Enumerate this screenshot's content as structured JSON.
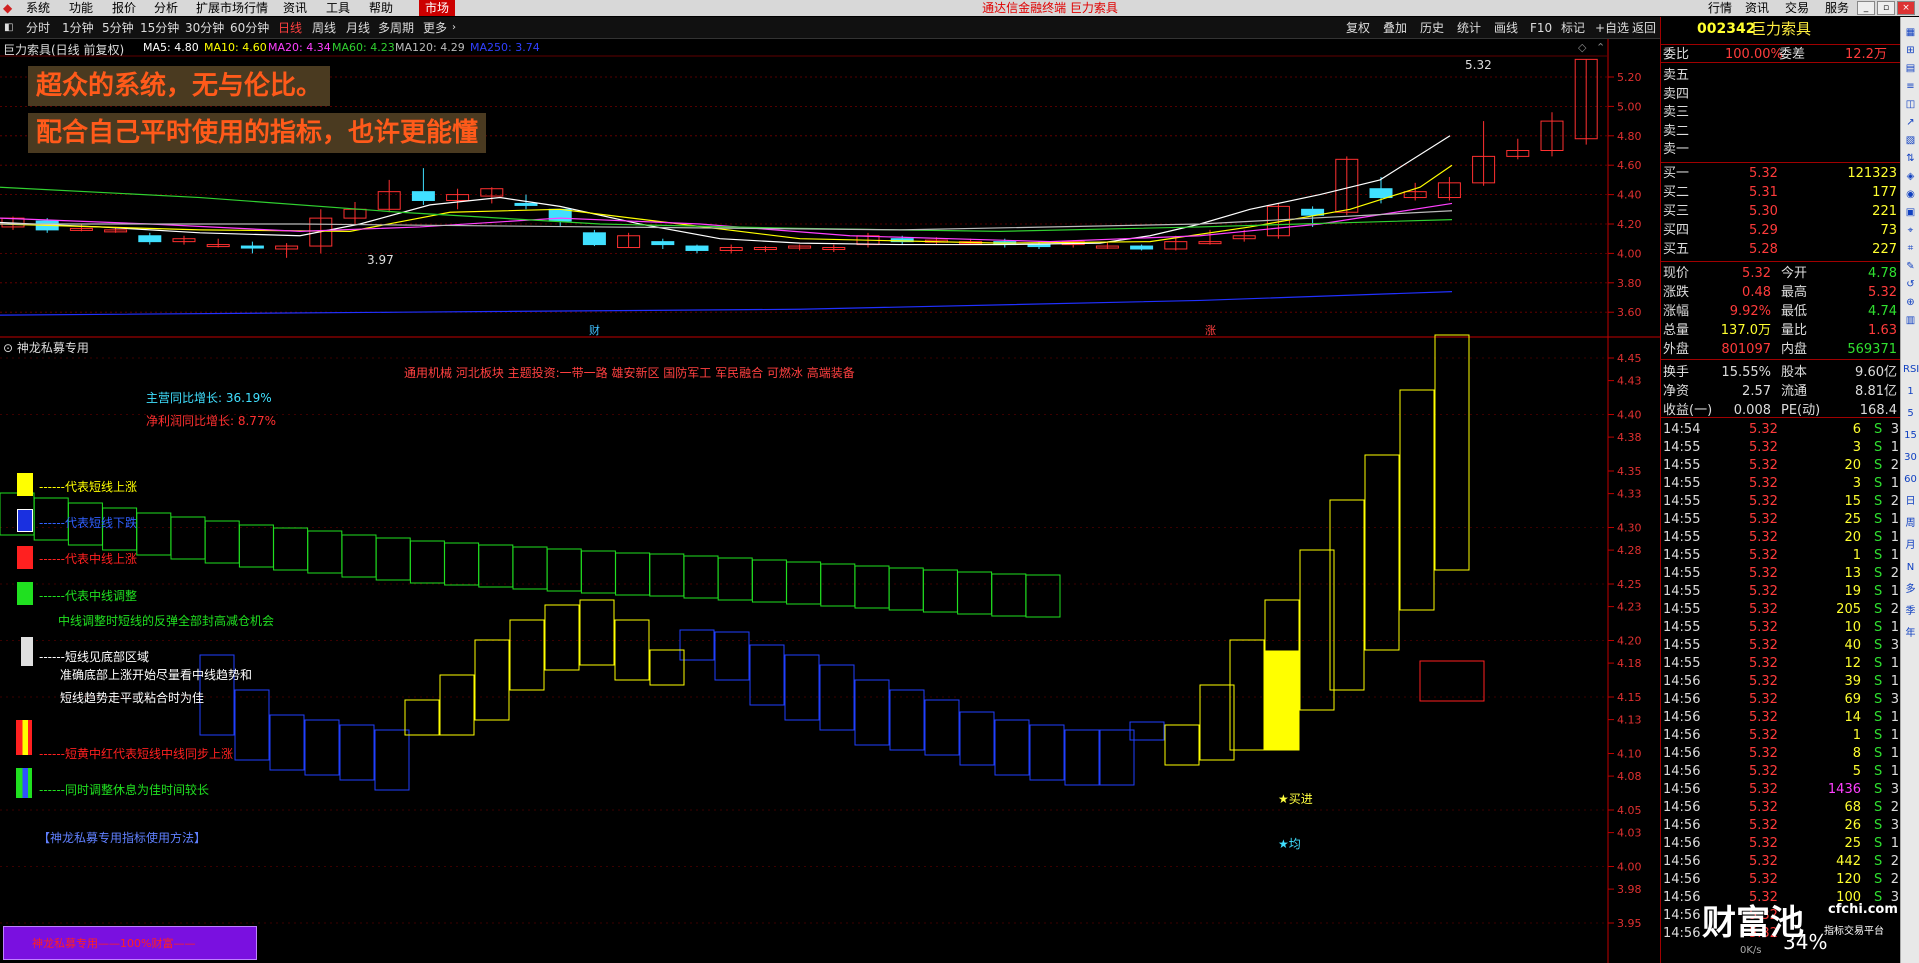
{
  "menu": {
    "items": [
      "系统",
      "功能",
      "报价",
      "分析",
      "扩展市场行情",
      "资讯",
      "工具",
      "帮助"
    ],
    "market": "市场",
    "app_title": "通达信金融终端  巨力索具",
    "right_items": [
      "行情",
      "资讯",
      "交易",
      "服务"
    ]
  },
  "periods": [
    "分时",
    "1分钟",
    "5分钟",
    "15分钟",
    "30分钟",
    "60分钟",
    "日线",
    "周线",
    "月线",
    "多周期",
    "更多"
  ],
  "active_period": "日线",
  "tools": [
    "复权",
    "叠加",
    "历史",
    "统计",
    "画线",
    "F10",
    "标记",
    "+自选",
    "返回"
  ],
  "kline": {
    "title": "巨力索具(日线 前复权)",
    "ma": [
      {
        "label": "MA5: 4.80",
        "color": "#ffffff"
      },
      {
        "label": "MA10: 4.60",
        "color": "#ffff00"
      },
      {
        "label": "MA20: 4.34",
        "color": "#ff40ff"
      },
      {
        "label": "MA60: 4.23",
        "color": "#30d030"
      },
      {
        "label": "MA120: 4.29",
        "color": "#bbbbbb"
      },
      {
        "label": "MA250: 3.74",
        "color": "#3040ff"
      }
    ],
    "high_label": "5.32",
    "low_label": "3.97",
    "marker_cai": "财",
    "marker_zhang": "涨",
    "y_ticks": [
      "5.20",
      "5.00",
      "4.80",
      "4.60",
      "4.40",
      "4.20",
      "4.00",
      "3.80",
      "3.60"
    ],
    "banner1": "超众的系统，无与伦比。",
    "banner2": "配合自己平时使用的指标，也许更能懂"
  },
  "indicator": {
    "title": "神龙私募专用",
    "concepts": "通用机械 河北板块 主题投资:一带一路 雄安新区 国防军工 军民融合 可燃冰 高端装备",
    "revenue": "主营同比增长: 36.19%",
    "profit": "净利润同比增长: 8.77%",
    "legend": [
      {
        "text": "------代表短线上涨",
        "color": "#ffff00"
      },
      {
        "text": "------代表短线下跌",
        "color": "#3060ff"
      },
      {
        "text": "------代表中线上涨",
        "color": "#ff2020"
      },
      {
        "text": "------代表中线调整",
        "color": "#20e020"
      },
      {
        "text": "中线调整时短线的反弹全部封高减仓机会",
        "color": "#20e020"
      },
      {
        "text": "------短线见底部区域",
        "color": "#ffffff"
      },
      {
        "text": "准确底部上涨开始尽量看中线趋势和",
        "color": "#ffffff"
      },
      {
        "text": "短线趋势走平或粘合时为佳",
        "color": "#ffffff"
      },
      {
        "text": "------短黄中红代表短线中线同步上涨",
        "color": "#ff2020"
      },
      {
        "text": "------同时调整休息为佳时间较长",
        "color": "#20e020"
      }
    ],
    "method_link": "【神龙私募专用指标使用方法】",
    "buy_label": "★买进",
    "avg_label": "★均",
    "footer_box": "神龙私募专用——100%财富——",
    "y_ticks": [
      "4.45",
      "4.43",
      "4.40",
      "4.38",
      "4.35",
      "4.33",
      "4.30",
      "4.28",
      "4.25",
      "4.23",
      "4.20",
      "4.18",
      "4.15",
      "4.13",
      "4.10",
      "4.08",
      "4.05",
      "4.03",
      "4.00",
      "3.98",
      "3.95"
    ]
  },
  "quote": {
    "code": "002342",
    "name": "巨力索具",
    "wb_label": "委比",
    "wb": "100.00%",
    "wc_label": "委差",
    "wc": "12.2万",
    "asks": [
      "卖五",
      "卖四",
      "卖三",
      "卖二",
      "卖一"
    ],
    "bids": [
      {
        "label": "买一",
        "price": "5.32",
        "vol": "121323"
      },
      {
        "label": "买二",
        "price": "5.31",
        "vol": "177"
      },
      {
        "label": "买三",
        "price": "5.30",
        "vol": "221"
      },
      {
        "label": "买四",
        "price": "5.29",
        "vol": "73"
      },
      {
        "label": "买五",
        "price": "5.28",
        "vol": "227"
      }
    ],
    "stats": [
      {
        "l1": "现价",
        "v1": "5.32",
        "c1": "red",
        "l2": "今开",
        "v2": "4.78",
        "c2": "green"
      },
      {
        "l1": "涨跌",
        "v1": "0.48",
        "c1": "red",
        "l2": "最高",
        "v2": "5.32",
        "c2": "red"
      },
      {
        "l1": "涨幅",
        "v1": "9.92%",
        "c1": "red",
        "l2": "最低",
        "v2": "4.74",
        "c2": "green"
      },
      {
        "l1": "总量",
        "v1": "137.0万",
        "c1": "yellow",
        "l2": "量比",
        "v2": "1.63",
        "c2": "red"
      },
      {
        "l1": "外盘",
        "v1": "801097",
        "c1": "red",
        "l2": "内盘",
        "v2": "569371",
        "c2": "green"
      },
      {
        "l1": "换手",
        "v1": "15.55%",
        "c1": "white",
        "l2": "股本",
        "v2": "9.60亿",
        "c2": "white"
      },
      {
        "l1": "净资",
        "v1": "2.57",
        "c1": "white",
        "l2": "流通",
        "v2": "8.81亿",
        "c2": "white"
      },
      {
        "l1": "收益(一)",
        "v1": "0.008",
        "c1": "white",
        "l2": "PE(动)",
        "v2": "168.4",
        "c2": "white"
      }
    ],
    "ticks": [
      {
        "t": "14:54",
        "p": "5.32",
        "v": "6",
        "n": "3"
      },
      {
        "t": "14:55",
        "p": "5.32",
        "v": "3",
        "n": "1"
      },
      {
        "t": "14:55",
        "p": "5.32",
        "v": "20",
        "n": "2"
      },
      {
        "t": "14:55",
        "p": "5.32",
        "v": "3",
        "n": "1"
      },
      {
        "t": "14:55",
        "p": "5.32",
        "v": "15",
        "n": "2"
      },
      {
        "t": "14:55",
        "p": "5.32",
        "v": "25",
        "n": "1"
      },
      {
        "t": "14:55",
        "p": "5.32",
        "v": "20",
        "n": "1"
      },
      {
        "t": "14:55",
        "p": "5.32",
        "v": "1",
        "n": "1"
      },
      {
        "t": "14:55",
        "p": "5.32",
        "v": "13",
        "n": "2"
      },
      {
        "t": "14:55",
        "p": "5.32",
        "v": "19",
        "n": "1"
      },
      {
        "t": "14:55",
        "p": "5.32",
        "v": "205",
        "n": "2"
      },
      {
        "t": "14:55",
        "p": "5.32",
        "v": "10",
        "n": "1"
      },
      {
        "t": "14:55",
        "p": "5.32",
        "v": "40",
        "n": "3"
      },
      {
        "t": "14:55",
        "p": "5.32",
        "v": "12",
        "n": "1"
      },
      {
        "t": "14:56",
        "p": "5.32",
        "v": "39",
        "n": "1"
      },
      {
        "t": "14:56",
        "p": "5.32",
        "v": "69",
        "n": "3"
      },
      {
        "t": "14:56",
        "p": "5.32",
        "v": "14",
        "n": "1"
      },
      {
        "t": "14:56",
        "p": "5.32",
        "v": "1",
        "n": "1"
      },
      {
        "t": "14:56",
        "p": "5.32",
        "v": "8",
        "n": "1"
      },
      {
        "t": "14:56",
        "p": "5.32",
        "v": "5",
        "n": "1"
      },
      {
        "t": "14:56",
        "p": "5.32",
        "v": "1436",
        "n": "3"
      },
      {
        "t": "14:56",
        "p": "5.32",
        "v": "68",
        "n": "2"
      },
      {
        "t": "14:56",
        "p": "5.32",
        "v": "26",
        "n": "3"
      },
      {
        "t": "14:56",
        "p": "5.32",
        "v": "25",
        "n": "1"
      },
      {
        "t": "14:56",
        "p": "5.32",
        "v": "442",
        "n": "2"
      },
      {
        "t": "14:56",
        "p": "5.32",
        "v": "120",
        "n": "2"
      },
      {
        "t": "14:56",
        "p": "5.32",
        "v": "100",
        "n": "3"
      },
      {
        "t": "14:56",
        "p": "5.32",
        "v": "",
        "n": ""
      },
      {
        "t": "14:56",
        "p": "5.32",
        "v": "",
        "n": ""
      }
    ]
  },
  "watermark": {
    "brand": "财富池",
    "url": "cfchi.com",
    "sub": "指标交易平台",
    "pct": "34%",
    "speed": "0K/s"
  },
  "sidebar_labels": [
    "RSI",
    "1",
    "5",
    "15",
    "30",
    "60",
    "日",
    "周",
    "月",
    "N",
    "多",
    "季",
    "年"
  ]
}
